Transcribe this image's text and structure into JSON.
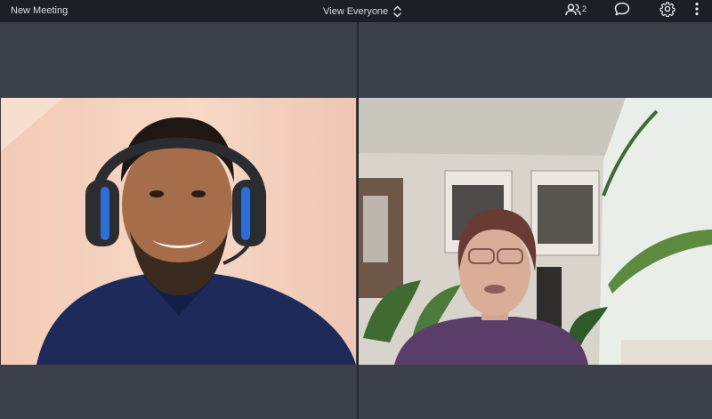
{
  "header": {
    "title": "New Meeting",
    "view_label": "View Everyone",
    "participant_count": "2"
  },
  "icons": {
    "participants": "participants-icon",
    "chat": "chat-icon",
    "settings": "gear-icon",
    "more": "more-vertical-icon",
    "view_toggle": "chevron-up-down-icon"
  },
  "colors": {
    "topbar": "#1c2026",
    "tile_background": "#3b4049",
    "text": "#d9dde2"
  },
  "participants": [
    {
      "position": "left"
    },
    {
      "position": "right"
    }
  ]
}
